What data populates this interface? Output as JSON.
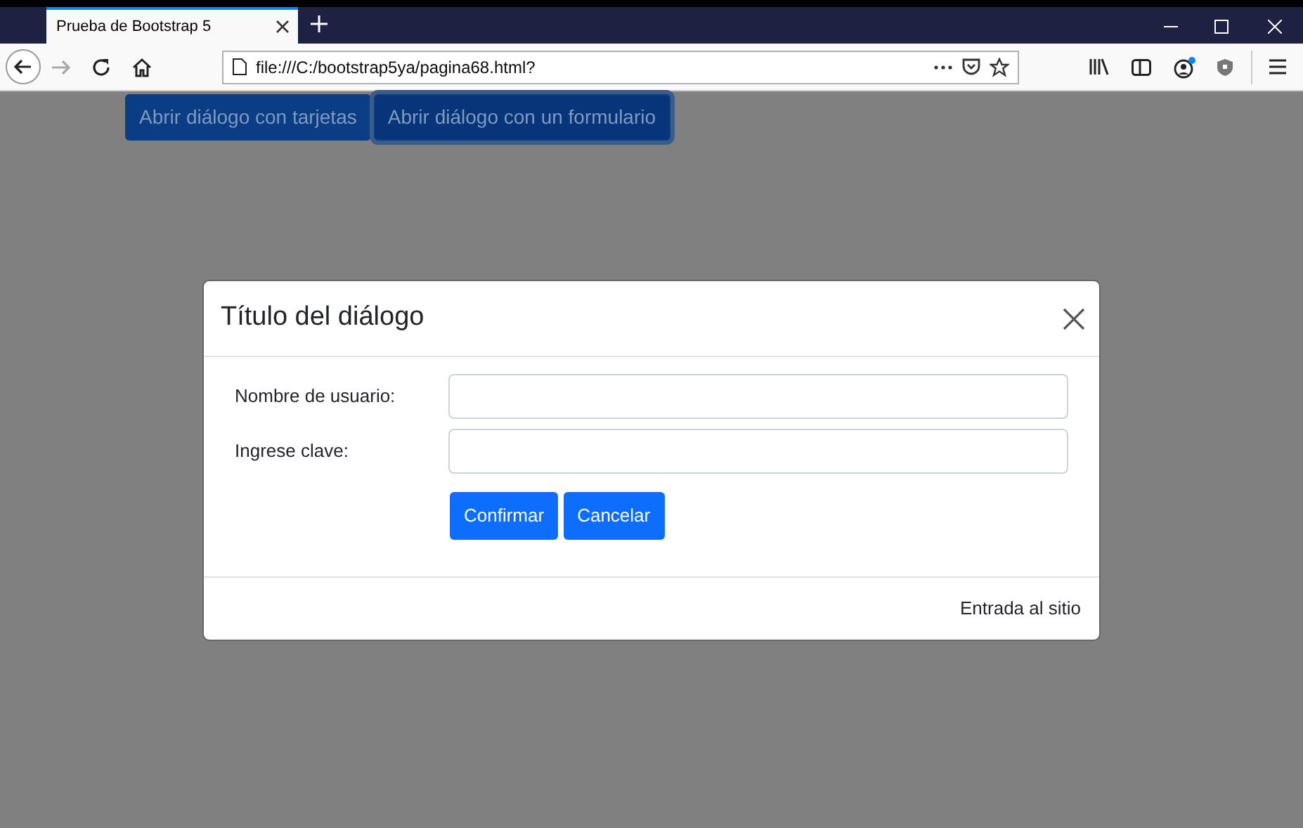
{
  "browser": {
    "tab_title": "Prueba de Bootstrap 5",
    "url": "file:///C:/bootstrap5ya/pagina68.html?"
  },
  "page_buttons": [
    {
      "label": "Abrir diálogo con tarjetas",
      "focused": false
    },
    {
      "label": "Abrir diálogo con un formulario",
      "focused": true
    }
  ],
  "dialog": {
    "title": "Título del diálogo",
    "fields": [
      {
        "label": "Nombre de usuario:"
      },
      {
        "label": "Ingrese clave:"
      }
    ],
    "buttons": [
      "Confirmar",
      "Cancelar"
    ],
    "footer": "Entrada al sitio"
  }
}
